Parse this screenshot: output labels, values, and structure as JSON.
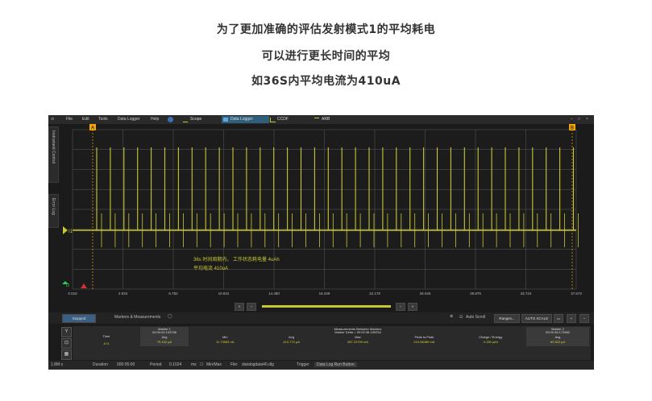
{
  "captions": [
    "为了更加准确的评估发射模式1的平均耗电",
    "可以进行更长时间的平均",
    "如36S内平均电流为410uA"
  ],
  "menu": [
    "File",
    "Edit",
    "Tools",
    "Data Logger",
    "Help"
  ],
  "tabs": [
    {
      "label": "Scope",
      "icon": "scope-icon"
    },
    {
      "label": "Data Logger",
      "icon": "data-logger-icon"
    },
    {
      "label": "CCDF",
      "icon": "ccdf-icon"
    },
    {
      "label": "ARB",
      "icon": "arb-icon"
    }
  ],
  "side_tabs": [
    "Instrument Control",
    "Error Log"
  ],
  "marker_labels": {
    "a": "A",
    "b": "B"
  },
  "channel_labels": {
    "i1": "I1",
    "i2": "I2"
  },
  "x_ticks": [
    "0.016",
    "2.933",
    "6.782",
    "10.631",
    "14.480",
    "18.329",
    "22.178",
    "26.026",
    "29.875",
    "33.724",
    "37.573"
  ],
  "annotation": {
    "line1": "36s 时间周期内， 工作状态耗电量 4uAh",
    "line2": "平均电流 410uA"
  },
  "controls": {
    "stopped": "Stopped",
    "markers_measurements": "Markers & Measurements",
    "auto_scroll": "Auto Scroll",
    "ranges": "Ranges...",
    "auto_scale": "AUTO SCALE"
  },
  "table": {
    "time_label": "Time",
    "marker1": {
      "title": "Marker 1",
      "time": "00:00:00.102236",
      "avg_label": "Avg",
      "value": "79.432 µA"
    },
    "between": {
      "title": "Measurements Between Markers",
      "sub": "Marker Delta = 00:00:36.180234"
    },
    "cols": [
      {
        "label": "Min",
        "value": "11.73653 nA"
      },
      {
        "label": "Avg",
        "value": "410.773 µA"
      },
      {
        "label": "Max",
        "value": "287.10799 mA"
      },
      {
        "label": "Peak to Peak",
        "value": "219.08480 mA"
      },
      {
        "label": "Charge / Energy",
        "value": "4.138 µAh"
      }
    ],
    "marker2": {
      "title": "Marker 2",
      "time": "00:00:36.172862",
      "avg_label": "Avg",
      "value": "82.822 µA"
    },
    "row_label": "A I1"
  },
  "status": {
    "range": "1.8M s",
    "duration_label": "Duration",
    "duration_value": "000:05:00",
    "period_label": "Period",
    "period_value": "0.1024",
    "period_unit": "ms",
    "minmax": "Min/Max",
    "file_label": "File:",
    "file_value": "datalogdata40.dlg",
    "trigger_label": "Trigger",
    "trigger_value": "Data Log Run Button"
  },
  "colors": {
    "trace": "#c8c832",
    "marker": "#f0a500",
    "grid": "#5a5a5a",
    "plot_bg": "#1c1c1c"
  }
}
